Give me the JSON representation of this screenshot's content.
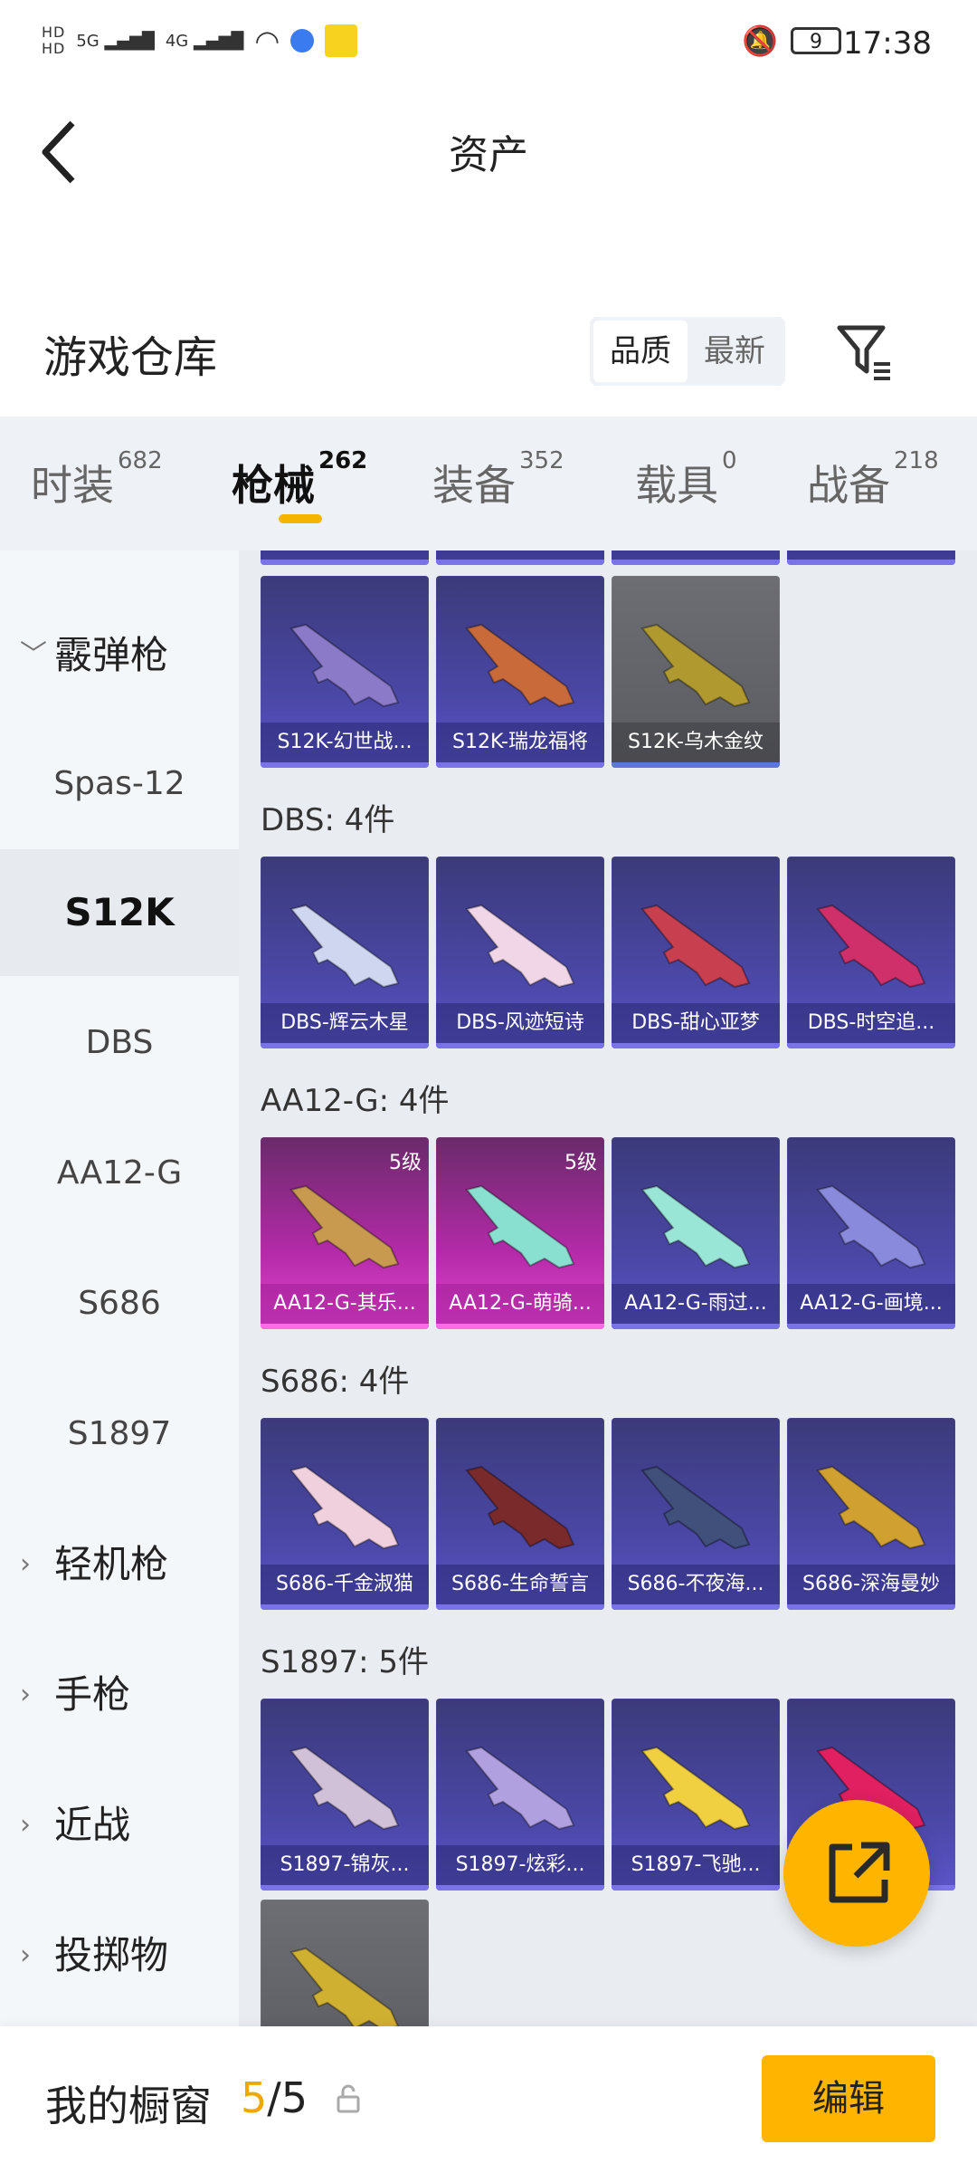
{
  "status_bar": {
    "hd1": "HD",
    "hd2": "HD",
    "net1": "5G",
    "net2": "4G",
    "battery": "9",
    "time": "17:38",
    "icons": [
      "wifi-icon",
      "signal-icon",
      "app-icon",
      "bell-off-icon",
      "battery-icon"
    ]
  },
  "header": {
    "title": "资产"
  },
  "section": {
    "title": "游戏仓库",
    "sort_options": [
      "品质",
      "最新"
    ],
    "active_sort": "品质"
  },
  "tabs": [
    {
      "label": "时装",
      "count": "682"
    },
    {
      "label": "枪械",
      "count": "262"
    },
    {
      "label": "装备",
      "count": "352"
    },
    {
      "label": "载具",
      "count": "0"
    },
    {
      "label": "战备",
      "count": "218"
    }
  ],
  "active_tab": "枪械",
  "sidebar": [
    {
      "label": "霰弹枪",
      "type": "category",
      "expanded": true
    },
    {
      "label": "Spas-12",
      "type": "sub"
    },
    {
      "label": "S12K",
      "type": "sub",
      "active": true
    },
    {
      "label": "DBS",
      "type": "sub"
    },
    {
      "label": "AA12-G",
      "type": "sub"
    },
    {
      "label": "S686",
      "type": "sub"
    },
    {
      "label": "S1897",
      "type": "sub"
    },
    {
      "label": "轻机枪",
      "type": "category",
      "expanded": false
    },
    {
      "label": "手枪",
      "type": "category",
      "expanded": false
    },
    {
      "label": "近战",
      "type": "category",
      "expanded": false
    },
    {
      "label": "投掷物",
      "type": "category",
      "expanded": false
    }
  ],
  "groups": {
    "s12k": {
      "items": [
        {
          "name": "S12K-幻世战...",
          "style": "purple",
          "gun": "#8a7ac8"
        },
        {
          "name": "S12K-瑞龙福将",
          "style": "purple",
          "gun": "#c86a3a"
        },
        {
          "name": "S12K-乌木金纹",
          "style": "gray",
          "gun": "#b09a30"
        }
      ]
    },
    "dbs": {
      "header": "DBS: 4件",
      "items": [
        {
          "name": "DBS-辉云木星",
          "style": "purple",
          "gun": "#cfd6f0"
        },
        {
          "name": "DBS-风迹短诗",
          "style": "purple",
          "gun": "#f0d6e6"
        },
        {
          "name": "DBS-甜心亚梦",
          "style": "purple",
          "gun": "#c84050"
        },
        {
          "name": "DBS-时空追...",
          "style": "purple",
          "gun": "#d0306a"
        }
      ]
    },
    "aa12g": {
      "header": "AA12-G: 4件",
      "items": [
        {
          "name": "AA12-G-其乐...",
          "style": "pink",
          "gun": "#c89a50",
          "level": "5级"
        },
        {
          "name": "AA12-G-萌骑...",
          "style": "pink",
          "gun": "#8ae0d0",
          "level": "5级"
        },
        {
          "name": "AA12-G-雨过...",
          "style": "purple",
          "gun": "#9ae6d6"
        },
        {
          "name": "AA12-G-画境...",
          "style": "purple",
          "gun": "#8a8adc"
        }
      ]
    },
    "s686": {
      "header": "S686: 4件",
      "items": [
        {
          "name": "S686-千金淑猫",
          "style": "purple",
          "gun": "#f0d0dc"
        },
        {
          "name": "S686-生命誓言",
          "style": "purple",
          "gun": "#7a2a2a"
        },
        {
          "name": "S686-不夜海...",
          "style": "purple",
          "gun": "#40507a"
        },
        {
          "name": "S686-深海曼妙",
          "style": "purple",
          "gun": "#d0a030"
        }
      ]
    },
    "s1897": {
      "header": "S1897: 5件",
      "items": [
        {
          "name": "S1897-锦灰...",
          "style": "purple",
          "gun": "#d0c0d8"
        },
        {
          "name": "S1897-炫彩...",
          "style": "purple",
          "gun": "#b0a0e0"
        },
        {
          "name": "S1897-飞驰...",
          "style": "purple",
          "gun": "#f0d040"
        },
        {
          "name": "",
          "style": "purple",
          "gun": "#e02060"
        },
        {
          "name": "",
          "style": "gray",
          "gun": "#d0b030"
        }
      ]
    }
  },
  "showcase": {
    "label": "我的橱窗",
    "current": "5",
    "total": "/5",
    "edit_label": "编辑"
  },
  "colors": {
    "accent": "#ffb400",
    "card_purple": "#4b48a8",
    "card_pink": "#b42aa8"
  }
}
